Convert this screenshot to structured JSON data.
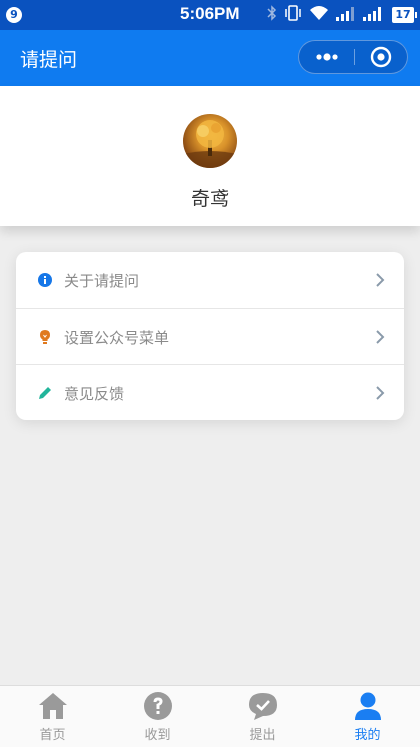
{
  "status_bar": {
    "notification_badge": "9",
    "time": "5:06PM",
    "battery": "17",
    "icons": [
      "bluetooth-icon",
      "vibrate-icon",
      "wifi-icon",
      "signal-icon",
      "signal-icon",
      "battery-icon"
    ]
  },
  "nav": {
    "title": "请提问",
    "more_icon": "more-dots-icon",
    "close_icon": "target-circle-icon"
  },
  "profile": {
    "username": "奇鸢"
  },
  "menu": {
    "items": [
      {
        "label": "关于请提问",
        "icon": "info-icon",
        "color": "#1677e8"
      },
      {
        "label": "设置公众号菜单",
        "icon": "lightbulb-icon",
        "color": "#e07a1f"
      },
      {
        "label": "意见反馈",
        "icon": "pencil-icon",
        "color": "#22b59b"
      }
    ]
  },
  "tabs": [
    {
      "label": "首页",
      "icon": "home-icon",
      "active": false
    },
    {
      "label": "收到",
      "icon": "question-icon",
      "active": false
    },
    {
      "label": "提出",
      "icon": "chat-check-icon",
      "active": false
    },
    {
      "label": "我的",
      "icon": "person-icon",
      "active": true
    }
  ],
  "colors": {
    "nav_blue": "#0f7bf0",
    "status_blue": "#0a52bf",
    "tab_active": "#1a7ef2",
    "tab_inactive": "#999999",
    "background": "#eeeeee"
  }
}
